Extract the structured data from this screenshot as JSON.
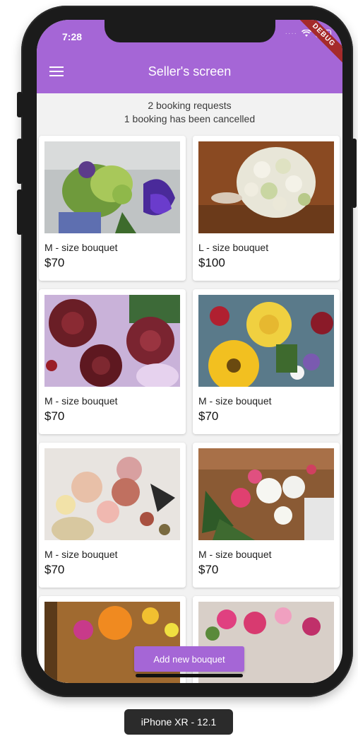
{
  "status": {
    "time": "7:28",
    "debug": "DEBUG"
  },
  "appbar": {
    "title": "Seller's screen"
  },
  "notices": {
    "line1": "2 booking requests",
    "line2": "1 booking has been cancelled"
  },
  "bouquets": [
    {
      "name": "M - size bouquet",
      "price": "$70"
    },
    {
      "name": "L - size bouquet",
      "price": "$100"
    },
    {
      "name": "M - size bouquet",
      "price": "$70"
    },
    {
      "name": "M - size bouquet",
      "price": "$70"
    },
    {
      "name": "M - size bouquet",
      "price": "$70"
    },
    {
      "name": "M - size bouquet",
      "price": "$70"
    }
  ],
  "actions": {
    "add_label": "Add new bouquet"
  },
  "device": {
    "label": "iPhone XR - 12.1"
  },
  "colors": {
    "accent": "#a566d6",
    "background": "#f2f2f2"
  }
}
